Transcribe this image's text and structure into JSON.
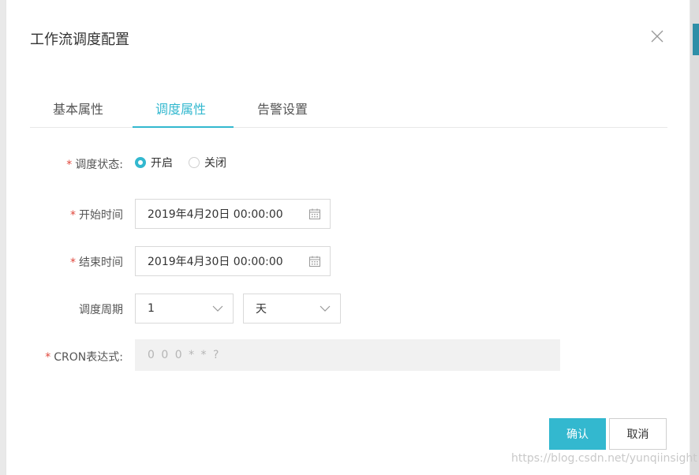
{
  "dialog": {
    "title": "工作流调度配置"
  },
  "tabs": [
    {
      "label": "基本属性"
    },
    {
      "label": "调度属性"
    },
    {
      "label": "告警设置"
    }
  ],
  "active_tab": "调度属性",
  "form": {
    "status": {
      "label": "调度状态:",
      "required_mark": "*",
      "options": [
        {
          "label": "开启",
          "checked": true
        },
        {
          "label": "关闭",
          "checked": false
        }
      ]
    },
    "start_time": {
      "label": "开始时间",
      "required_mark": "*",
      "value": "2019年4月20日 00:00:00"
    },
    "end_time": {
      "label": "结束时间",
      "required_mark": "*",
      "value": "2019年4月30日 00:00:00"
    },
    "period": {
      "label": "调度周期",
      "count_value": "1",
      "unit_value": "天"
    },
    "cron": {
      "label": "CRON表达式:",
      "required_mark": "*",
      "value": "0 0 0 * * ?"
    }
  },
  "buttons": {
    "confirm": "确认",
    "cancel": "取消"
  },
  "watermark": "https://blog.csdn.net/yunqiinsight",
  "colors": {
    "accent": "#33b8cf",
    "required": "#e0463b"
  },
  "icons": {
    "close": "close-icon",
    "calendar": "calendar-icon",
    "dropdown": "chevron-down-icon"
  }
}
